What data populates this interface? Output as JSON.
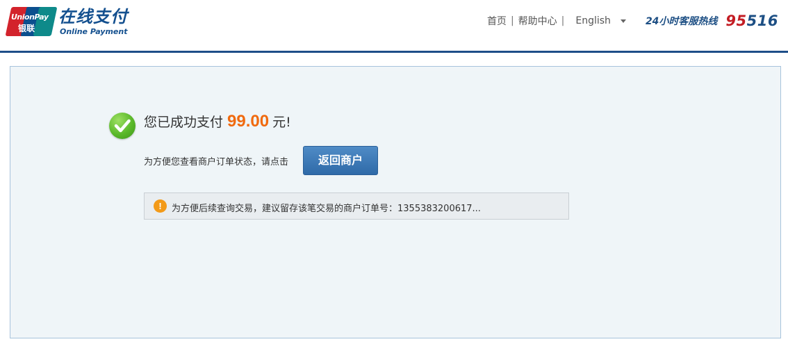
{
  "header": {
    "logo": {
      "brand_en": "UnionPay",
      "brand_cn": "银联",
      "title_cn": "在线支付",
      "title_en": "Online Payment"
    },
    "nav": {
      "home": "首页",
      "separator": "|",
      "help": "帮助中心",
      "language": "English",
      "hotline_label": "24小时客服热线",
      "hotline_number_prefix": "95",
      "hotline_number_suffix": "516"
    }
  },
  "main": {
    "success_prefix": "您已成功支付",
    "amount": "99.00",
    "success_suffix": "元!",
    "hint": "为方便您查看商户订单状态，请点击",
    "return_button": "返回商户",
    "notice": "为方便后续查询交易，建议留存该笔交易的商户订单号：1355383200617..."
  },
  "colors": {
    "brand_blue": "#1e4e88",
    "amount_orange": "#f06a0f",
    "button_blue": "#2f6aa8",
    "success_green": "#5ab82a",
    "info_orange": "#f39a18",
    "hotline_red": "#c31d24"
  },
  "icons": {
    "success": "check-circle-icon",
    "info": "info-circle-icon",
    "language_dropdown": "chevron-down-icon"
  }
}
